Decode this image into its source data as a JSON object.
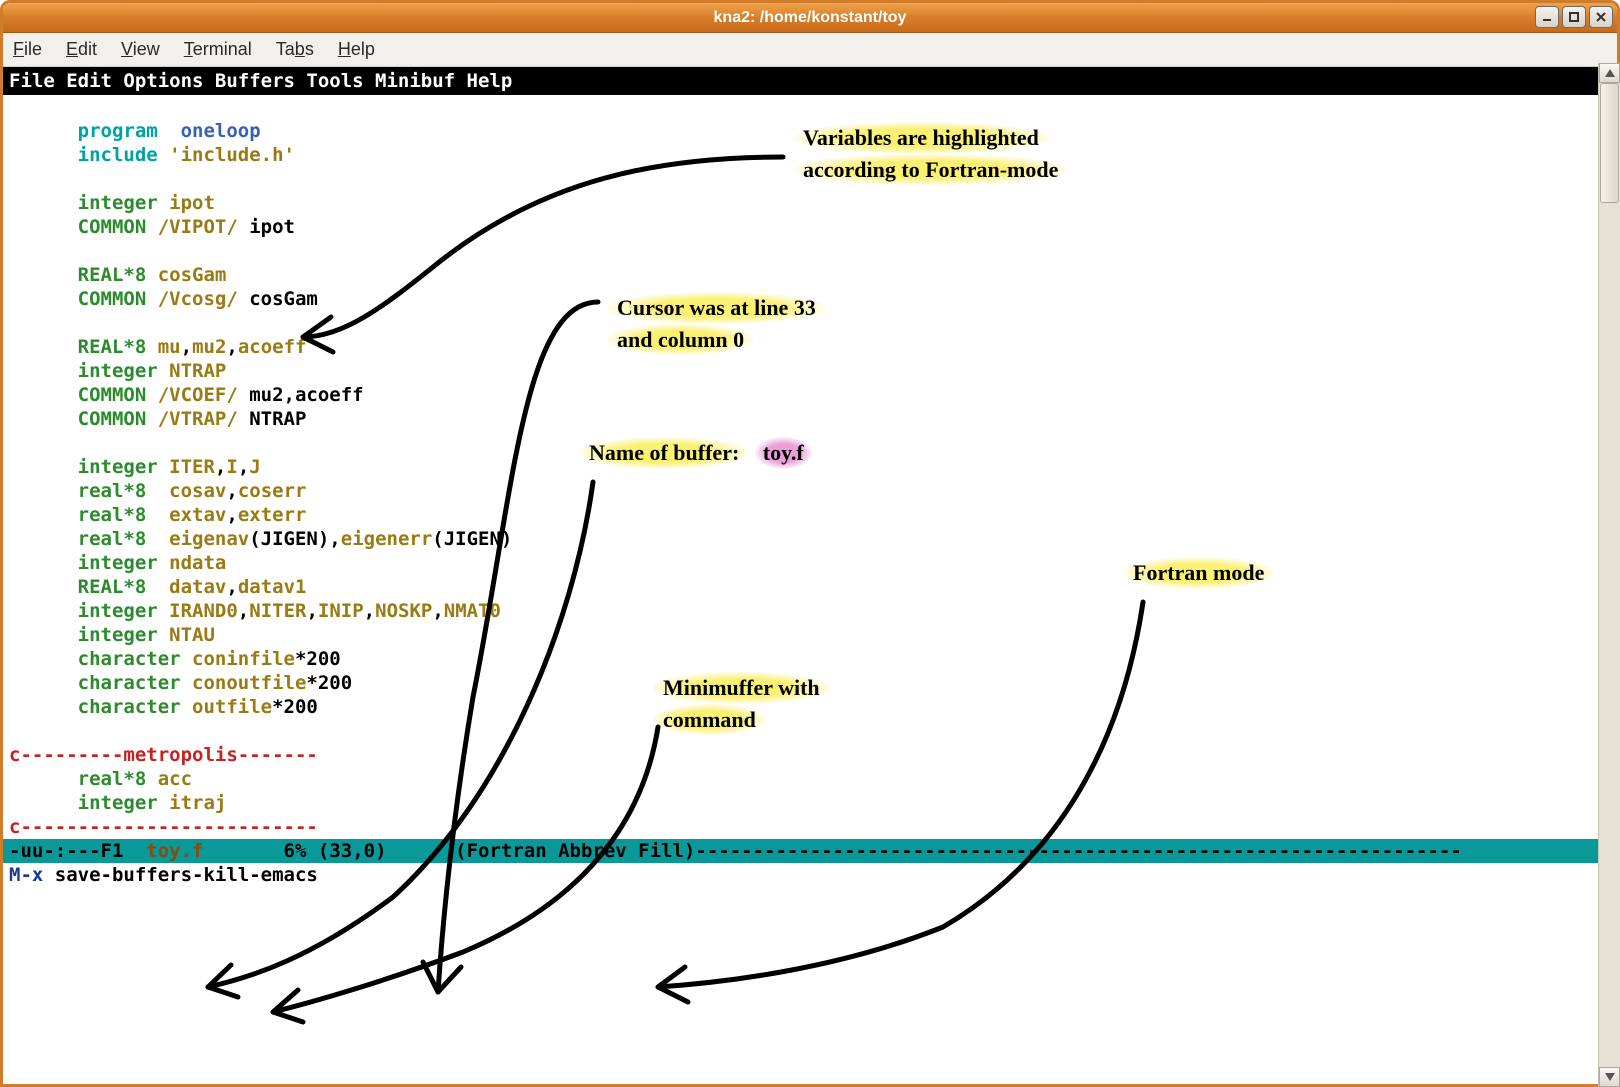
{
  "window": {
    "title": "kna2: /home/konstant/toy"
  },
  "gnome_menu": {
    "file": "File",
    "edit": "Edit",
    "view": "View",
    "terminal": "Terminal",
    "tabs": "Tabs",
    "help": "Help"
  },
  "emacs_menu": "File Edit Options Buffers Tools Minibuf Help",
  "code": {
    "l1_kw": "program",
    "l1_name": "oneloop",
    "l2_kw": "include",
    "l2_str": "'include.h'",
    "l4_kw": "integer",
    "l4_var": "ipot",
    "l5_kw": "COMMON ",
    "l5_blk": "/VIPOT/",
    "l5_var": " ipot",
    "l7_kw": "REAL*8 ",
    "l7_var": "cosGam",
    "l8_kw": "COMMON ",
    "l8_blk": "/Vcosg/",
    "l8_var": " cosGam",
    "l10_kw": "REAL*8 ",
    "l10_v1": "mu",
    "l10_c1": ",",
    "l10_v2": "mu2",
    "l10_c2": ",",
    "l10_v3": "acoeff",
    "l11_kw": "integer ",
    "l11_var": "NTRAP",
    "l12_kw": "COMMON ",
    "l12_blk": "/VCOEF/",
    "l12_var": " mu2,acoeff",
    "l13_kw": "COMMON ",
    "l13_blk": "/VTRAP/",
    "l13_var": " NTRAP",
    "l15_kw": "integer ",
    "l15_v1": "ITER",
    "l15_c1": ",",
    "l15_v2": "I",
    "l15_c2": ",",
    "l15_v3": "J",
    "l16_kw": "real*8  ",
    "l16_v1": "cosav",
    "l16_c1": ",",
    "l16_v2": "coserr",
    "l17_kw": "real*8  ",
    "l17_v1": "extav",
    "l17_c1": ",",
    "l17_v2": "exterr",
    "l18_kw": "real*8  ",
    "l18_v1": "eigenav",
    "l18_p1": "(JIGEN),",
    "l18_v2": "eigenerr",
    "l18_p2": "(JIGEN)",
    "l19_kw": "integer ",
    "l19_var": "ndata",
    "l20_kw": "REAL*8  ",
    "l20_v1": "datav",
    "l20_c1": ",",
    "l20_v2": "datav1",
    "l21_kw": "integer ",
    "l21_v1": "IRAND0",
    "l21_c1": ",",
    "l21_v2": "NITER",
    "l21_c2": ",",
    "l21_v3": "INIP",
    "l21_c3": ",",
    "l21_v4": "NOSKP",
    "l21_c4": ",",
    "l21_v5": "NMAT0",
    "l22_kw": "integer ",
    "l22_var": "NTAU",
    "l23_kw": "character ",
    "l23_var": "coninfile",
    "l23_sz": "*200",
    "l24_kw": "character ",
    "l24_var": "conoutfile",
    "l24_sz": "*200",
    "l25_kw": "character ",
    "l25_var": "outfile",
    "l25_sz": "*200",
    "l27": "c---------metropolis-------",
    "l28_kw": "real*8 ",
    "l28_var": "acc",
    "l29_kw": "integer ",
    "l29_var": "itraj",
    "l30": "c--------------------------"
  },
  "modeline": {
    "left": "-uu-:---F1  ",
    "buffer": "toy.f",
    "mid": "       6% (33,0)      (Fortran Abbrev Fill)",
    "dashes": "-------------------------------------------------------------------"
  },
  "minibuffer": {
    "prompt": "M-x ",
    "cmd": "save-buffers-kill-emacs"
  },
  "annotations": {
    "a1_l1": "Variables are highlighted",
    "a1_l2": "according to Fortran-mode",
    "a2_l1": "Cursor was at line 33",
    "a2_l2": "and column 0",
    "a3_label": "Name of buffer:",
    "a3_buf": "toy.f",
    "a4": "Fortran mode",
    "a5_l1": "Minimuffer with",
    "a5_l2": "command"
  }
}
